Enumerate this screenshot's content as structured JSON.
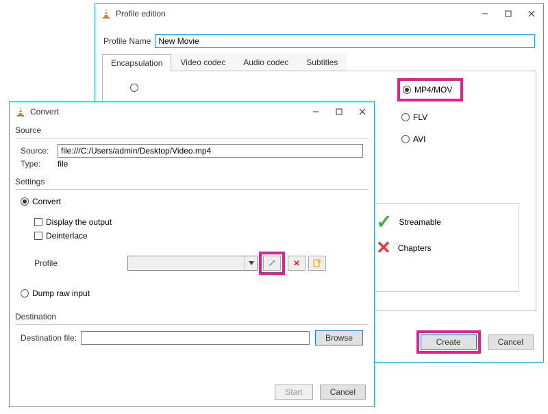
{
  "profile_window": {
    "title": "Profile edition",
    "profile_name_label": "Profile Name",
    "profile_name_value": "New Movie",
    "tabs": {
      "encapsulation": "Encapsulation",
      "video_codec": "Video codec",
      "audio_codec": "Audio codec",
      "subtitles": "Subtitles"
    },
    "encap_options": {
      "mp4": "MP4/MOV",
      "flv": "FLV",
      "avi": "AVI"
    },
    "features": {
      "streamable": "Streamable",
      "chapters": "Chapters"
    },
    "buttons": {
      "create": "Create",
      "cancel": "Cancel"
    }
  },
  "convert_window": {
    "title": "Convert",
    "source_group": "Source",
    "source_label": "Source:",
    "source_value": "file:///C:/Users/admin/Desktop/Video.mp4",
    "type_label": "Type:",
    "type_value": "file",
    "settings_group": "Settings",
    "convert_radio": "Convert",
    "display_output": "Display the output",
    "deinterlace": "Deinterlace",
    "profile_label": "Profile",
    "dump_raw": "Dump raw input",
    "destination_group": "Destination",
    "destination_file_label": "Destination file:",
    "destination_file_value": "",
    "buttons": {
      "browse": "Browse",
      "start": "Start",
      "cancel": "Cancel"
    }
  }
}
